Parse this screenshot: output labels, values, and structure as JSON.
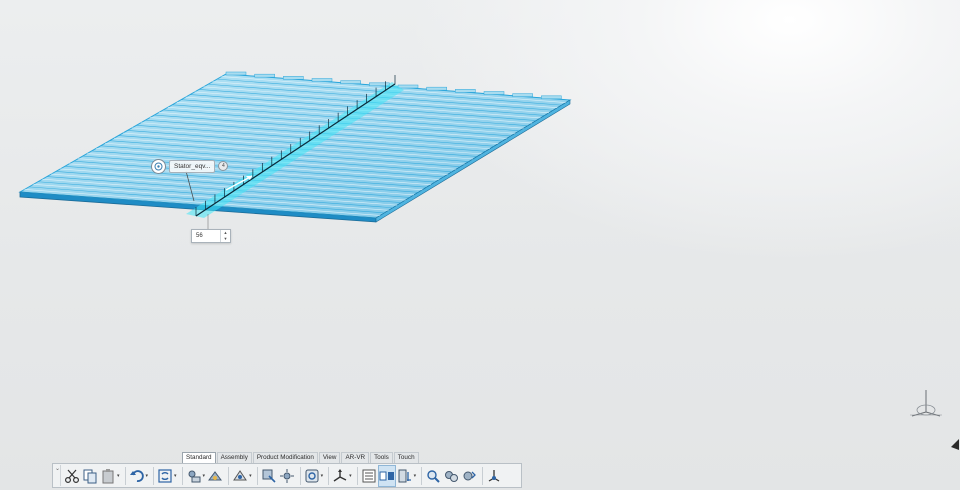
{
  "viewport": {
    "model_label": {
      "text": "Stator_eqv...",
      "badge": "4"
    },
    "spin_box": {
      "value": "56"
    },
    "icons": [
      "compass-icon",
      "triad-icon",
      "cursor-icon"
    ]
  },
  "action_bar": {
    "tabs": [
      {
        "label": "Standard",
        "active": true
      },
      {
        "label": "Assembly",
        "active": false
      },
      {
        "label": "Product Modification",
        "active": false
      },
      {
        "label": "View",
        "active": false
      },
      {
        "label": "AR-VR",
        "active": false
      },
      {
        "label": "Tools",
        "active": false
      },
      {
        "label": "Touch",
        "active": false
      }
    ],
    "tools": [
      "cut-icon",
      "copy-icon",
      "paste-icon",
      "undo-icon",
      "update-icon",
      "measure-icon",
      "catalog-icon",
      "render-style-icon",
      "fly-icon",
      "explode-icon",
      "view-mode-icon",
      "axis-icon",
      "tree-icon",
      "multi-view-icon",
      "zoom-icon",
      "hide-icon",
      "swap-icon",
      "compass-icon"
    ]
  },
  "colors": {
    "model_fill": "#8fd3ee",
    "model_line": "#2aa6db",
    "edge_dark": "#1b6b97",
    "highlight": "#3fe6f6",
    "background": "#e6e8e9"
  }
}
